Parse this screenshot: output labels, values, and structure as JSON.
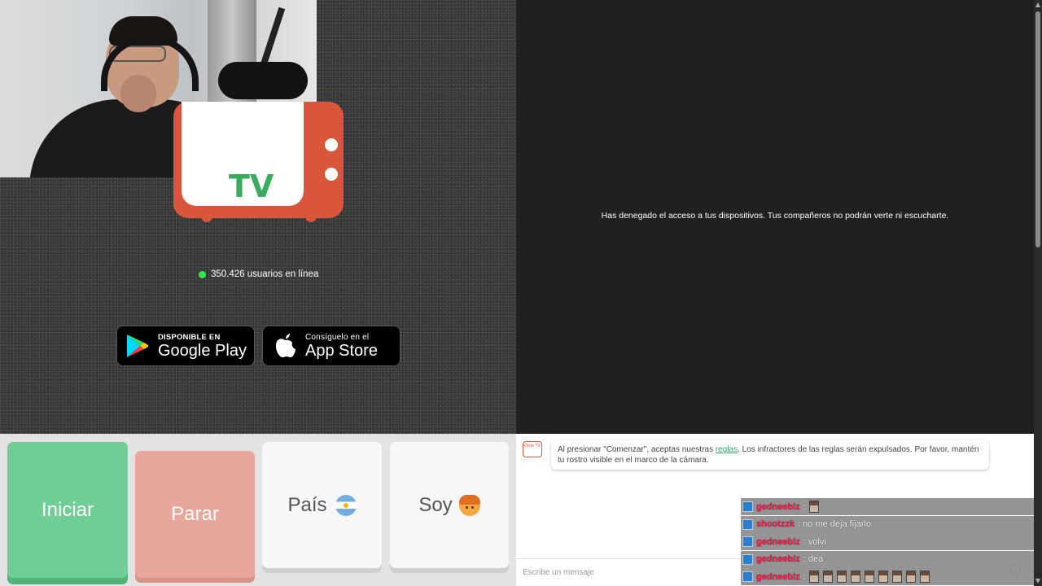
{
  "stats": {
    "online_text": "350.426 usuarios en línea",
    "status_color": "#36e84a"
  },
  "logo": {
    "tv_text": "TV",
    "brand_color": "#d9553b",
    "chat_logo_text": "Ome TV"
  },
  "stores": {
    "google_small": "Disponible en",
    "google_big": "Google Play",
    "apple_small": "Consíguelo en el",
    "apple_big": "App Store"
  },
  "partner": {
    "denied_message": "Has denegado el acceso a tus dispositivos. Tus compañeros no podrán verte ni escucharte."
  },
  "controls": {
    "start_label": "Iniciar",
    "stop_label": "Parar",
    "country_label": "País",
    "country_flag": "argentina-flag-icon",
    "gender_label": "Soy",
    "gender_icon": "boy-face-icon",
    "start_color": "#6fcd95",
    "stop_color": "#e9a79c"
  },
  "chat": {
    "notice_prefix": "Al presionar \"Comenzar\", aceptas nuestras ",
    "notice_link": "reglas",
    "notice_suffix": ". Los infractores de las reglas serán expulsados. Por favor, mantén tu rostro visible en el marco de la cámara.",
    "input_placeholder": "Escribe un mensaje"
  },
  "stream_chat": [
    {
      "user": "gedneeblz",
      "message": ":",
      "emotes": 1
    },
    {
      "user": "shootzzk",
      "message": ": no me deja fijarlo",
      "emotes": 0
    },
    {
      "user": "gedneeblz",
      "message": ": volvi",
      "emotes": 0
    },
    {
      "user": "gedneeblz",
      "message": ": dea",
      "emotes": 0
    },
    {
      "user": "gedneeblz",
      "message": ":",
      "emotes": 9
    }
  ]
}
